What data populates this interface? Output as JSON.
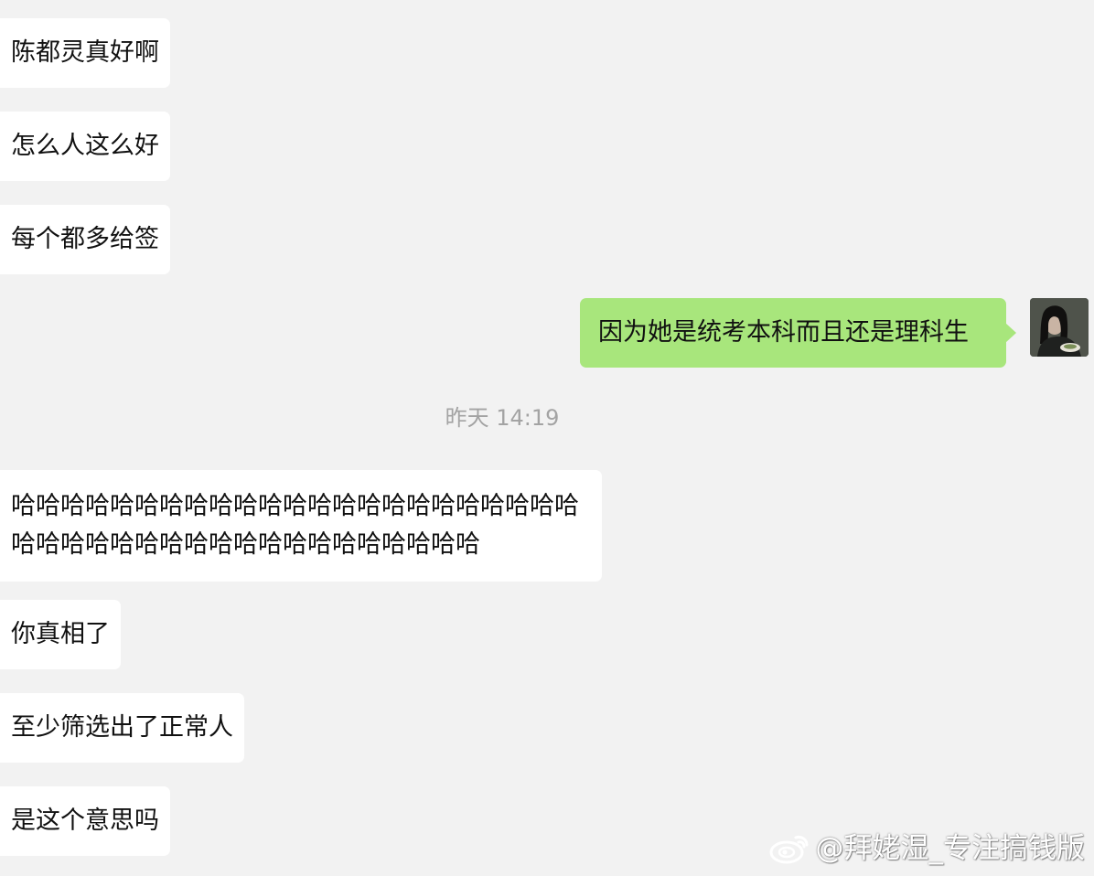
{
  "colors": {
    "background": "#f2f2f2",
    "incoming_bubble": "#ffffff",
    "outgoing_bubble": "#a8e67c",
    "timestamp": "#a3a3a3",
    "watermark": "#ffffff"
  },
  "messages": [
    {
      "side": "incoming",
      "text": "陈都灵真好啊"
    },
    {
      "side": "incoming",
      "text": "怎么人这么好"
    },
    {
      "side": "incoming",
      "text": "每个都多给签"
    },
    {
      "side": "outgoing",
      "text": "因为她是统考本科而且还是理科生"
    },
    {
      "side": "incoming",
      "text": "哈哈哈哈哈哈哈哈哈哈哈哈哈哈哈哈哈哈哈哈哈哈哈哈哈哈哈哈哈哈哈哈哈哈哈哈哈哈哈哈哈哈"
    },
    {
      "side": "incoming",
      "text": "你真相了"
    },
    {
      "side": "incoming",
      "text": "至少筛选出了正常人"
    },
    {
      "side": "incoming",
      "text": "是这个意思吗"
    }
  ],
  "timestamp": "昨天 14:19",
  "watermark": {
    "icon": "weibo-icon",
    "text": "@拜姥湿_专注搞钱版"
  }
}
